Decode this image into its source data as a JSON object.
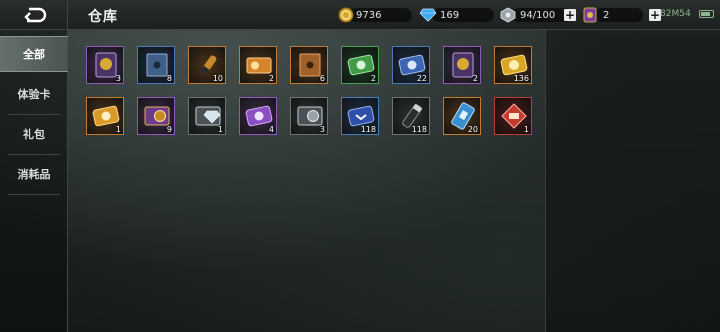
{
  "header": {
    "title": "仓库",
    "coins": "9736",
    "diamonds": "169",
    "stamina": "94/100",
    "tickets": "2",
    "status": "82M54",
    "plus": "+"
  },
  "sidebar": {
    "items": [
      {
        "label": "全部",
        "active": true
      },
      {
        "label": "体验卡",
        "active": false
      },
      {
        "label": "礼包",
        "active": false
      },
      {
        "label": "消耗品",
        "active": false
      }
    ]
  },
  "inventory": {
    "items": [
      {
        "name": "purple-coin-card",
        "qty": "3",
        "rarity": "purple",
        "color": "#6b3fa0"
      },
      {
        "name": "blue-book",
        "qty": "8",
        "rarity": "blue",
        "color": "#3f5f86"
      },
      {
        "name": "orange-bullet",
        "qty": "10",
        "rarity": "orange",
        "color": "#c6892e"
      },
      {
        "name": "orange-ticket",
        "qty": "2",
        "rarity": "orange",
        "color": "#d6842a"
      },
      {
        "name": "orange-book",
        "qty": "6",
        "rarity": "orange",
        "color": "#a0612a"
      },
      {
        "name": "green-lightning-card",
        "qty": "2",
        "rarity": "green",
        "color": "#3f9c47"
      },
      {
        "name": "blue-lightning-card",
        "qty": "22",
        "rarity": "blue",
        "color": "#3d64b5"
      },
      {
        "name": "purple-coin-card-2",
        "qty": "2",
        "rarity": "purple",
        "color": "#6b3fa0"
      },
      {
        "name": "gold-coin-card",
        "qty": "136",
        "rarity": "orange",
        "color": "#d9a628"
      },
      {
        "name": "gold-lightning-card",
        "qty": "1",
        "rarity": "orange",
        "color": "#d99a2a"
      },
      {
        "name": "purple-coin-ticket",
        "qty": "9",
        "rarity": "purple",
        "color": "#c58a24"
      },
      {
        "name": "diamond-ticket",
        "qty": "1",
        "rarity": "grey",
        "color": "#9aa8b4"
      },
      {
        "name": "purple-lightning-card",
        "qty": "4",
        "rarity": "purple",
        "color": "#8a4fc0"
      },
      {
        "name": "silver-coin-ticket",
        "qty": "3",
        "rarity": "grey",
        "color": "#9aa2a8"
      },
      {
        "name": "blue-rank-card",
        "qty": "118",
        "rarity": "blue",
        "color": "#2f4fa8"
      },
      {
        "name": "black-flashlight",
        "qty": "118",
        "rarity": "grey",
        "color": "#2a2d2e"
      },
      {
        "name": "blue-card",
        "qty": "20",
        "rarity": "orange",
        "color": "#3a8fd0"
      },
      {
        "name": "red-celebration-card",
        "qty": "1",
        "rarity": "red",
        "color": "#c33a2e"
      }
    ]
  },
  "colors": {
    "accent_purple": "#8c5ab8",
    "accent_blue": "#4b7ab8",
    "accent_orange": "#c47a2c",
    "accent_red": "#b63e36",
    "accent_green": "#4aa055"
  }
}
